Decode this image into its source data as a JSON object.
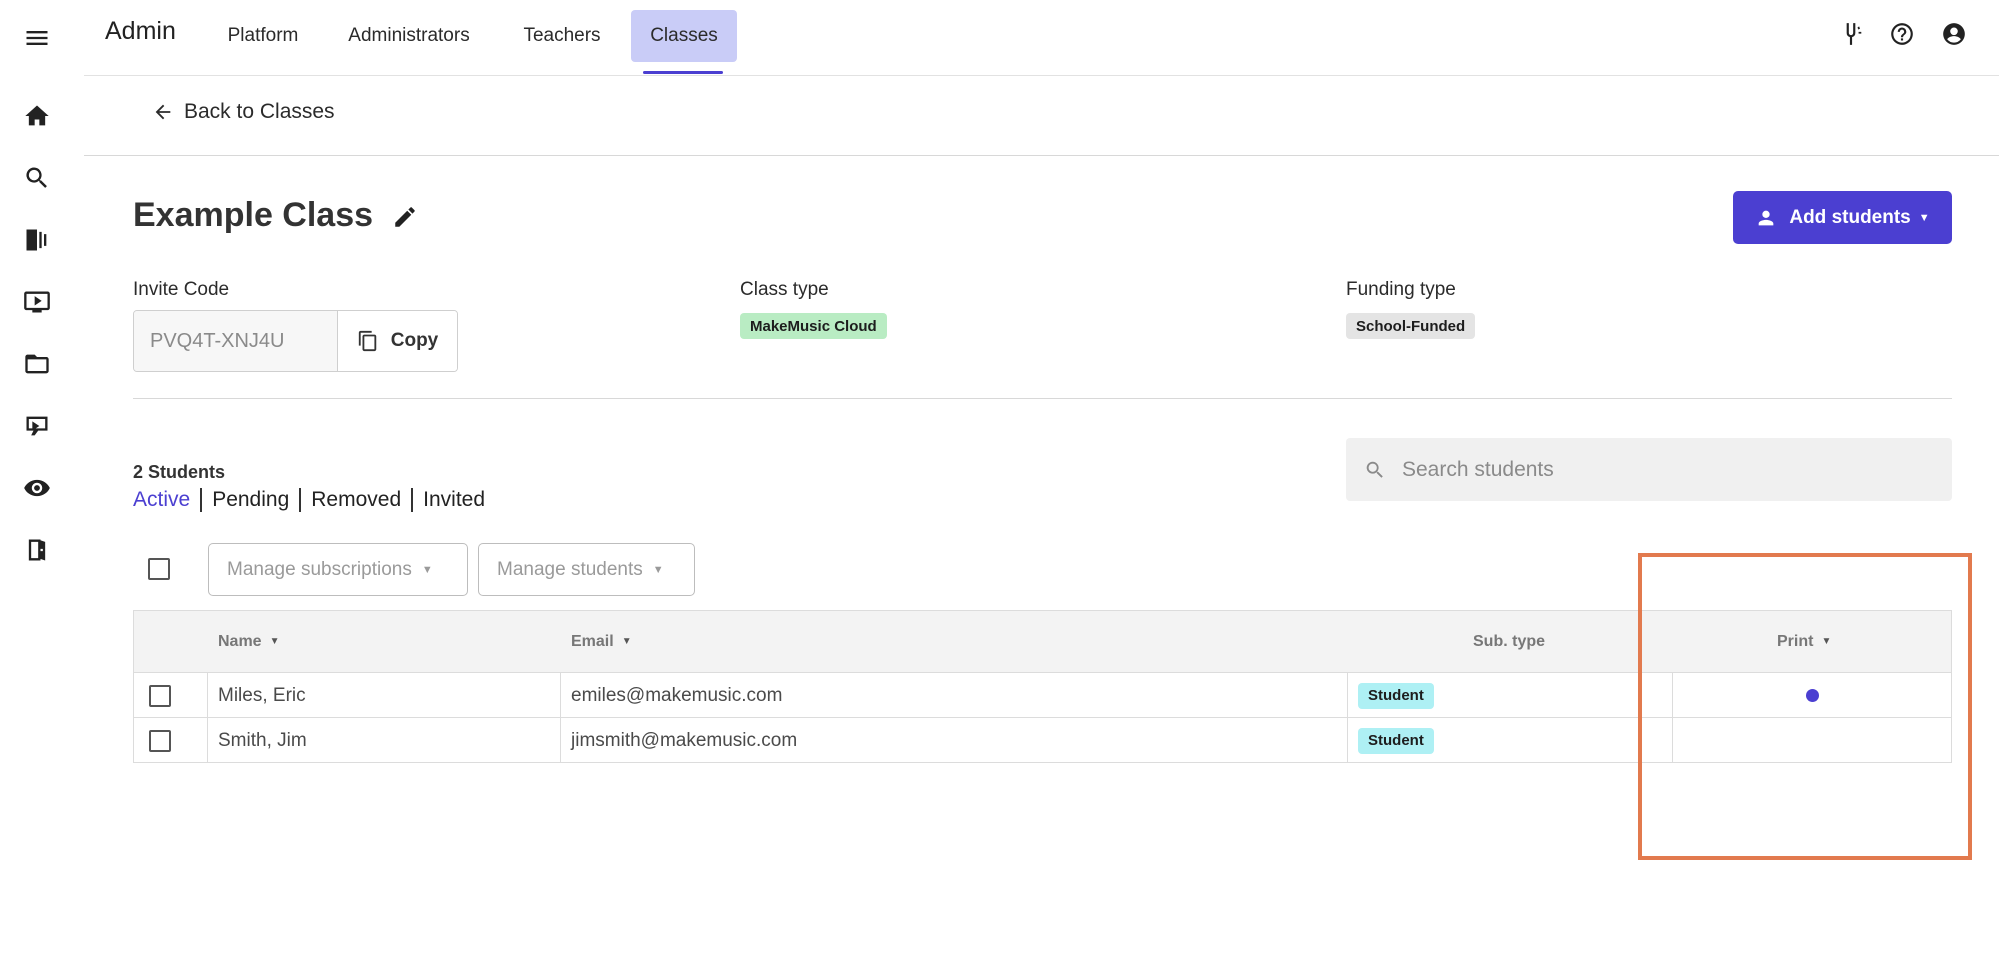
{
  "header": {
    "brand": "Admin",
    "nav": [
      {
        "label": "Platform",
        "active": false
      },
      {
        "label": "Administrators",
        "active": false
      },
      {
        "label": "Teachers",
        "active": false
      },
      {
        "label": "Classes",
        "active": true
      }
    ],
    "icons": [
      "tuning-fork-icon",
      "help-icon",
      "account-icon"
    ]
  },
  "sidebar": {
    "icons": [
      "menu-icon",
      "home-icon",
      "search-icon",
      "library-icon",
      "video-icon",
      "folder-icon",
      "teach-icon",
      "eye-icon",
      "exit-icon"
    ]
  },
  "back": {
    "label": "Back to Classes"
  },
  "class": {
    "title": "Example Class",
    "add_students_label": "Add students",
    "invite_label": "Invite Code",
    "invite_code": "PVQ4T-XNJ4U",
    "copy_label": "Copy",
    "class_type_label": "Class type",
    "class_type": "MakeMusic Cloud",
    "funding_type_label": "Funding type",
    "funding_type": "School-Funded"
  },
  "students": {
    "count_label": "2 Students",
    "filters": [
      {
        "label": "Active",
        "active": true
      },
      {
        "label": "Pending",
        "active": false
      },
      {
        "label": "Removed",
        "active": false
      },
      {
        "label": "Invited",
        "active": false
      }
    ],
    "search_placeholder": "Search students",
    "manage_subscriptions_label": "Manage subscriptions",
    "manage_students_label": "Manage students"
  },
  "table": {
    "columns": {
      "name": "Name",
      "email": "Email",
      "sub_type": "Sub. type",
      "print": "Print"
    },
    "rows": [
      {
        "name": "Miles, Eric",
        "email": "emiles@makemusic.com",
        "sub_type": "Student",
        "print": true
      },
      {
        "name": "Smith, Jim",
        "email": "jimsmith@makemusic.com",
        "sub_type": "Student",
        "print": false
      }
    ]
  },
  "colors": {
    "accent": "#4b3fd1",
    "nav_active_bg": "#c9ccf7",
    "class_type_badge": "#b9ecc3",
    "funding_badge": "#e4e4e4",
    "sub_badge": "#aef0f4",
    "highlight_box": "#e27a4e"
  }
}
